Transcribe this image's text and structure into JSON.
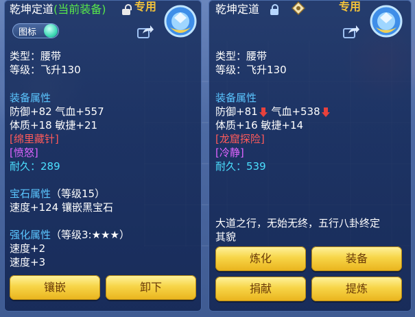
{
  "left": {
    "title": "乾坤定道",
    "title_suffix": "(当前装备)",
    "exclusive_badge": "专用",
    "toggle_label": "图标",
    "type_line": "类型：腰带",
    "level_line": "等级：飞升130",
    "attr_header": "装备属性",
    "attr_line1": "防御+82 气血+557",
    "attr_line2": "体质+18 敏捷+21",
    "special_skill": "[绵里藏针]",
    "special_effect": "[愤怒]",
    "durability_label": "耐久：",
    "durability_value": "289",
    "gem_header": "宝石属性",
    "gem_level": "（等级15）",
    "gem_line": "速度+124 镶嵌黑宝石",
    "enhance_header": "强化属性",
    "enhance_level": "（等级3:★★★）",
    "enhance_line1": "速度+2",
    "enhance_line2": "速度+3",
    "buttons": [
      "镶嵌",
      "卸下"
    ],
    "icons": [
      "lock-open-icon",
      "emblem-icon",
      "share-icon"
    ]
  },
  "right": {
    "title": "乾坤定道",
    "exclusive_badge": "专用",
    "type_line": "类型：腰带",
    "level_line": "等级：飞升130",
    "attr_header": "装备属性",
    "attr_def": "防御+81",
    "attr_hp": "气血+538",
    "attr_line2": "体质+16 敏捷+14",
    "special_skill": "[龙窟探险]",
    "special_effect": "[冷静]",
    "durability_label": "耐久：",
    "durability_value": "539",
    "description_line1": "大道之行，无始无终，五行八卦终定",
    "description_line2": "其貌",
    "buttons": [
      "炼化",
      "装备",
      "捐献",
      "提炼"
    ],
    "icons": [
      "lock-icon",
      "rating-diamond-icon",
      "emblem-icon",
      "share-icon",
      "down-arrow-icon"
    ]
  },
  "colors": {
    "title_white": "#ffffff",
    "current_equip_green": "#58e84a",
    "exclusive_gold": "#f2c23b",
    "header_blue": "#5bc6ff",
    "skill_red": "#ff5a5a",
    "effect_pink": "#e064ff",
    "durability_cyan": "#4ce0ff",
    "button_gold": "#f7d548"
  }
}
